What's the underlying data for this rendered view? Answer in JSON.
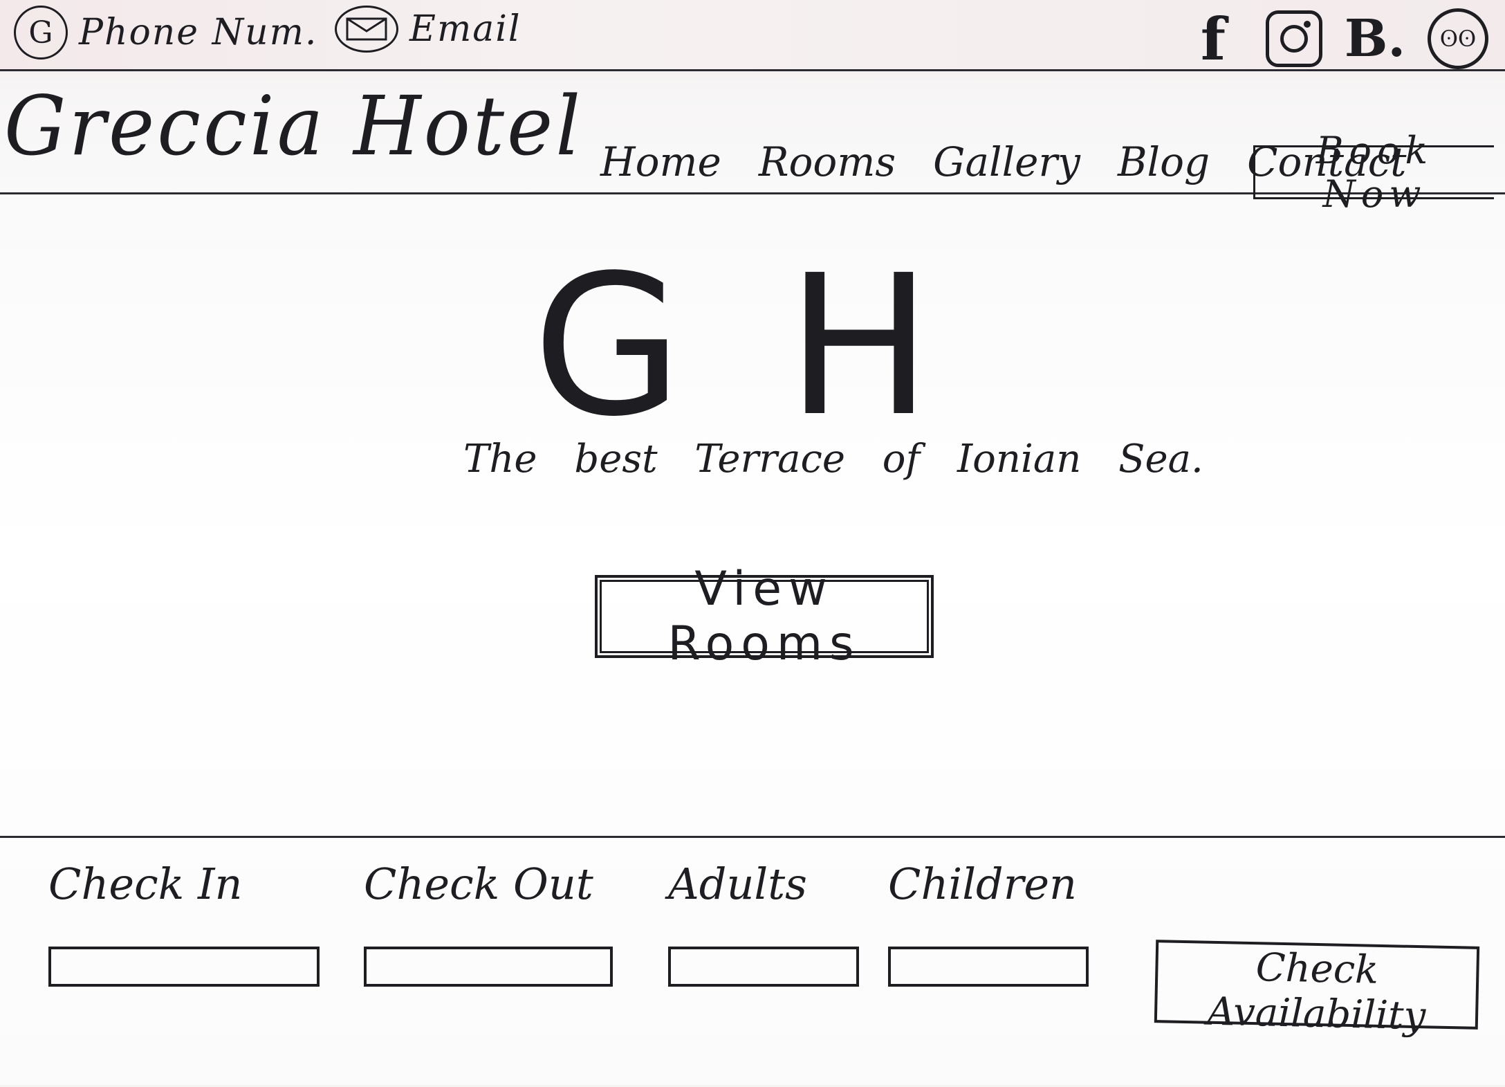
{
  "topbar": {
    "phone_icon_glyph": "G",
    "phone_label": "Phone Num.",
    "email_label": "Email",
    "social": [
      {
        "name": "facebook-icon",
        "glyph": "f"
      },
      {
        "name": "instagram-icon",
        "glyph": ""
      },
      {
        "name": "booking-icon",
        "glyph": "B."
      },
      {
        "name": "tripadvisor-icon",
        "glyph": "ʘʘ"
      }
    ]
  },
  "header": {
    "brand": "Greccia Hotel",
    "nav": [
      "Home",
      "Rooms",
      "Gallery",
      "Blog",
      "Contact"
    ],
    "book_now": "Book Now"
  },
  "hero": {
    "monogram": "GH",
    "tagline": "The best Terrace of Ionian Sea.",
    "view_rooms": "View Rooms"
  },
  "booking": {
    "check_in_label": "Check In",
    "check_out_label": "Check Out",
    "adults_label": "Adults",
    "children_label": "Children",
    "check_availability": "Check Availability"
  }
}
